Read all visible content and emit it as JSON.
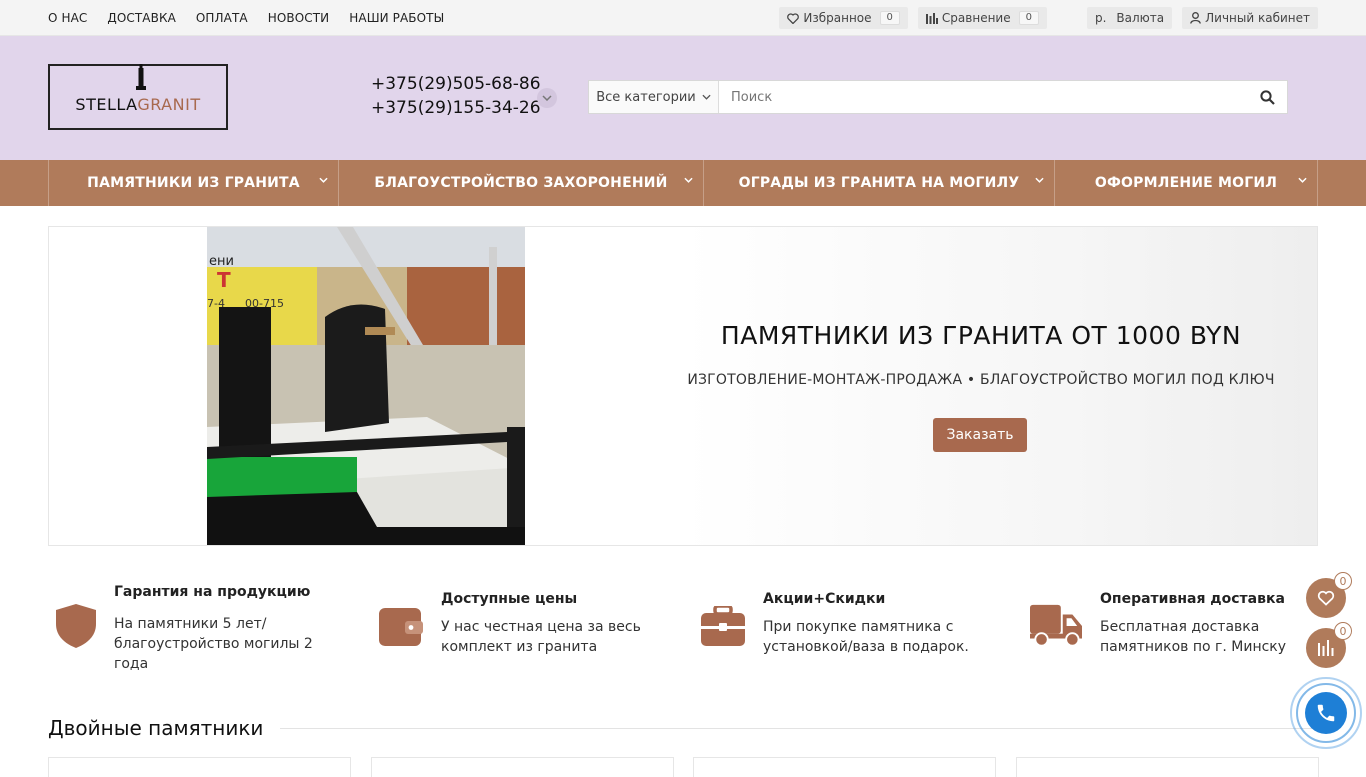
{
  "topnav": [
    "О НАС",
    "ДОСТАВКА",
    "ОПЛАТА",
    "НОВОСТИ",
    "НАШИ РАБОТЫ"
  ],
  "tools": {
    "favorites_label": "Избранное",
    "favorites_count": "0",
    "compare_label": "Сравнение",
    "compare_count": "0",
    "currency_symbol": "р.",
    "currency_label": "Валюта",
    "account_label": "Личный кабинет"
  },
  "logo": {
    "part1": "STELLA",
    "part2": "GRANIT"
  },
  "phones": [
    "+375(29)505-68-86",
    "+375(29)155-34-26"
  ],
  "search": {
    "category": "Все категории",
    "placeholder": "Поиск"
  },
  "menu": [
    "ПАМЯТНИКИ ИЗ ГРАНИТА",
    "БЛАГОУСТРОЙСТВО ЗАХОРОНЕНИЙ",
    "ОГРАДЫ ИЗ ГРАНИТА НА МОГИЛУ",
    "ОФОРМЛЕНИЕ МОГИЛ"
  ],
  "banner": {
    "title": "ПАМЯТНИКИ ИЗ ГРАНИТА ОТ 1000 BYN",
    "subtitle": "ИЗГОТОВЛЕНИЕ-МОНТАЖ-ПРОДАЖА • БЛАГОУСТРОЙСТВО МОГИЛ ПОД КЛЮЧ",
    "button": "Заказать",
    "photo_sign_lines": [
      "ени",
      "Т",
      "7-4",
      "00-715"
    ]
  },
  "features": [
    {
      "icon": "shield-icon",
      "title": "Гарантия на продукцию",
      "text": "На памятники 5 лет/ благоустройство могилы 2 года"
    },
    {
      "icon": "wallet-icon",
      "title": "Доступные цены",
      "text": "У нас честная цена за весь комплект из гранита"
    },
    {
      "icon": "briefcase-icon",
      "title": "Акции+Скидки",
      "text": "При покупке памятника с установкой/ваза в подарок."
    },
    {
      "icon": "truck-icon",
      "title": "Оперативная доставка",
      "text": "Бесплатная доставка памятников по г. Минску"
    }
  ],
  "section_title": "Двойные памятники",
  "floating": {
    "favorites_count": "0",
    "compare_count": "0"
  },
  "colors": {
    "accent": "#b07b5b",
    "button": "#a8694e",
    "header_bg": "#e1d5eb",
    "call": "#1e7fd6"
  }
}
